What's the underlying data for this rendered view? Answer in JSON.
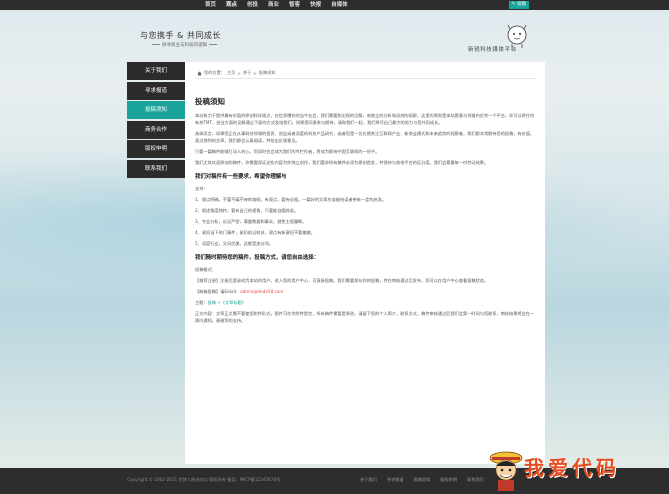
{
  "topnav": {
    "items": [
      "首页",
      "观点",
      "创投",
      "商业",
      "智客",
      "快报",
      "自媒体"
    ],
    "active_index": 1,
    "contribute_label": "投稿"
  },
  "header": {
    "title": "与您携手 & 共同成长",
    "subtitle": "探寻商业与科技的逻辑",
    "slogan": "新锐科技媒体平台"
  },
  "sidebar": {
    "items": [
      "关于我们",
      "寻求报道",
      "投稿须知",
      "商务合作",
      "版权申明",
      "联系我们"
    ],
    "active_index": 2
  },
  "breadcrumb": {
    "prefix": "您的位置：",
    "home": "主页",
    "sep1": " > ",
    "about": "关于",
    "sep2": " > ",
    "current": "投稿须知"
  },
  "article": {
    "title": "投稿须知",
    "para1": "本站致力于提供最有价值的原创科技观点，在信息爆炸的当今社会，我们需要和尖锐的见解，有独立的分析和深刻的观察，这里的原则是本站愿意与领域内优秀一个平台，你可以将任何有关TMT、创业方面的见解通过下面的方式发给我们，如果您同意参与期待，请和我们一起，我们将尽自己最大的努力与您共同成长。",
    "para2": "具体而言，如果您正在从事科技领域的投资、创业或者深度的科技产品研究，或者您是一位长期关注互联网产业、新商业模式和未来趋势的观察者，我们都非常期待您的投稿，有价值、观点独到的文章，我们都会认真阅读，并给出反馈意见。",
    "para3": "只要一篇稿件能够打动人的心，您同时也会成为我们的专栏作者，将成为影响中国互联网的一份子。",
    "para4": "我们尤其欢迎原创的稿件，你需要保证这些内容为你独立创作，我们要求所有稿件必须为原创首发，并保持与其他平台的区分度，我们会尊重每一份劳动成果。",
    "section1_title": "我们对稿件有一些要求，希望你理解与",
    "support_label": "支持：",
    "list": [
      "1、观点明确，不要不痛不痒的堆砌，有观点，要有论据，一篇好的文章应该能给读者带来一定的启发。",
      "2、叙述角度独特，要有自己的视角，只要能自圆其说。",
      "3、专业分析，论证严密，尊重数据和事实，避免主观臆断。",
      "4、紧扣当下热门事件，紧扣前沿科技，观点有新意但不要偏激。",
      "5、深度行业，文风优美，这都是加分项。"
    ],
    "section2_title": "我们随时期待您的稿件，投稿方式，请您自由选择：",
    "method_label": "投稿格式：",
    "method1": "【推荐注册】注册后登录成为本站的用户，进入您的用户中心，可直接投稿。我们需要保存你的投稿，并在审核通过后发布，您可以在用户中心查看投稿状态。",
    "method2_prefix": "【邮箱投稿】请Email：",
    "email": "admin@dede58.com",
    "method3_prefix": "主题：",
    "method3_value": "投稿 +《文章标题》",
    "footnote": "正文内容：文章正文需不要使用附件形式，图片可作为附件提交，所有稿件需要是原创，请留下您的个人简介，联系方式，稿件审核通过后我们会第一时间与您联系，审核结果将会在一周内通知，谢谢您的支持。"
  },
  "footer": {
    "copyright": "Copyright © 2002-2011 织梦人原创站点 版权所有 备案：粤ICP备12345678号",
    "links": [
      "关于我们",
      "寻求报道",
      "投稿须知",
      "版权申明",
      "联系我们"
    ]
  },
  "watermark": {
    "text": "我爱代码"
  },
  "colors": {
    "accent": "#1aa39a",
    "dark": "#2b2b2b",
    "watermark": "#e84d1f"
  }
}
